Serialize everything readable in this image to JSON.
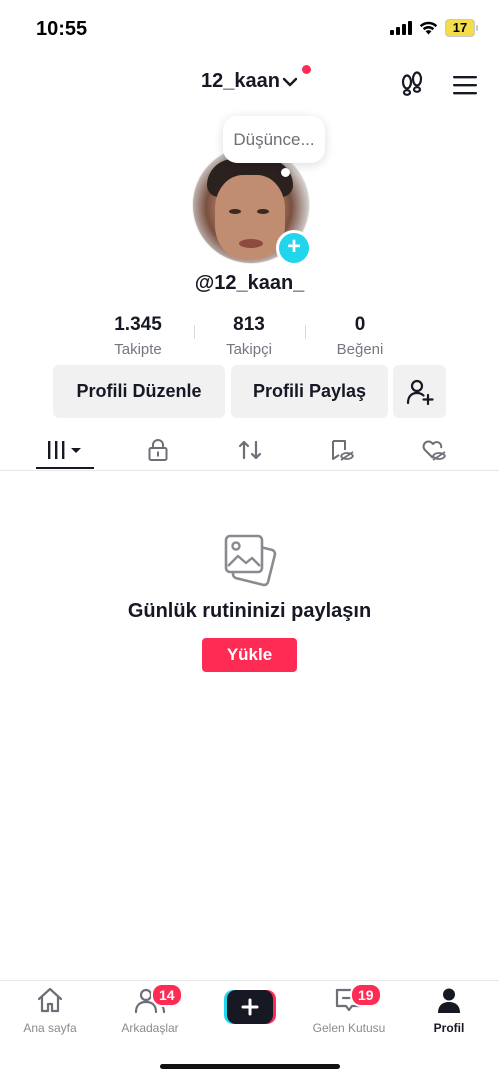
{
  "status_bar": {
    "time": "10:55",
    "battery": "17"
  },
  "header": {
    "username": "12_kaan"
  },
  "bubble": {
    "text": "Düşünce..."
  },
  "profile": {
    "handle": "@12_kaan_"
  },
  "stats": [
    {
      "value": "1.345",
      "label": "Takipte"
    },
    {
      "value": "813",
      "label": "Takipçi"
    },
    {
      "value": "0",
      "label": "Beğeni"
    }
  ],
  "actions": {
    "edit": "Profili Düzenle",
    "share": "Profili Paylaş"
  },
  "tabs": [
    "videos",
    "private",
    "reposts",
    "favorites",
    "liked"
  ],
  "empty_state": {
    "title": "Günlük rutininizi paylaşın",
    "button": "Yükle"
  },
  "bottom_nav": {
    "home": "Ana sayfa",
    "friends": "Arkadaşlar",
    "friends_badge": "14",
    "inbox": "Gelen Kutusu",
    "inbox_badge": "19",
    "profile": "Profil"
  },
  "colors": {
    "accent": "#fe2c55",
    "cyan": "#20d5ec"
  }
}
